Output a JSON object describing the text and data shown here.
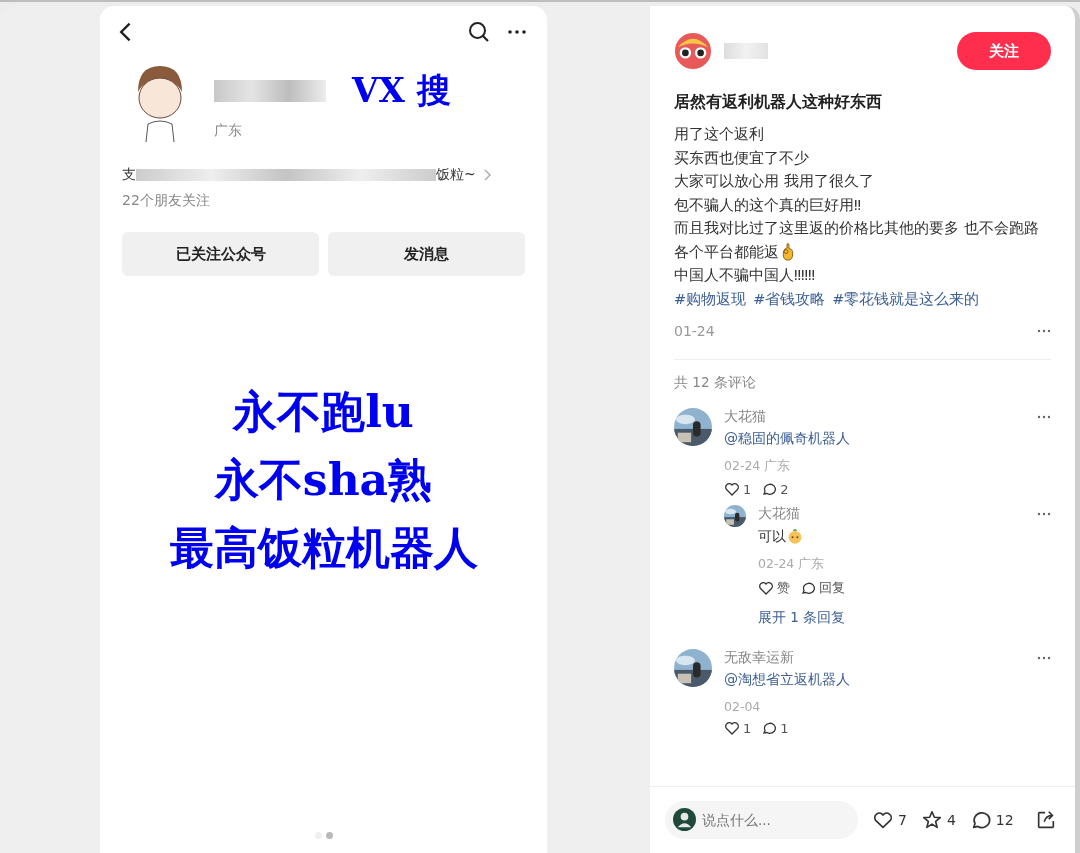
{
  "image_panel": {
    "profile": {
      "vx_label": "VX 搜",
      "region": "广东",
      "bio_start": "支",
      "bio_end": "饭粒~",
      "friends": "22个朋友关注",
      "buttons": [
        "已关注公众号",
        "发消息"
      ]
    },
    "slogan_lines": [
      "永不跑lu",
      "永不sha熟",
      "最高饭粒机器人"
    ],
    "pager": [
      {
        "selected": false
      },
      {
        "selected": true
      }
    ]
  },
  "post": {
    "follow_button": "关注",
    "title": "居然有返利机器人这种好东西",
    "body_lines": [
      {
        "text": "用了这个返利",
        "emoji": false
      },
      {
        "text": "买东西也便宜了不少",
        "emoji": false
      },
      {
        "text": "大家可以放心用 我用了很久了",
        "emoji": false
      },
      {
        "text": "包不骗人的这个真的巨好用‼",
        "emoji": false
      },
      {
        "text": "而且我对比过了这里返的价格比其他的要多 也不会跑路",
        "emoji": false
      },
      {
        "text": "各个平台都能返",
        "emoji": true
      },
      {
        "text": "中国人不骗中国人‼‼‼",
        "emoji": false
      }
    ],
    "tags": [
      "#购物返现",
      "#省钱攻略",
      "#零花钱就是这么来的"
    ],
    "date": "01-24"
  },
  "comments": {
    "count_label": "共 12 条评论",
    "items": [
      {
        "user": "大花猫",
        "text": "@稳固的佩奇机器人",
        "kind": "mention",
        "emoji": false,
        "meta": "02-24 广东",
        "likes": "1",
        "replies": "2",
        "children": [
          {
            "user": "大花猫",
            "text": "可以",
            "kind": "plain",
            "emoji": true,
            "meta": "02-24 广东",
            "likes": "赞",
            "replies": "回复"
          }
        ],
        "expand": "展开 1 条回复"
      },
      {
        "user": "无敌幸运新",
        "text": "@淘想省立返机器人",
        "kind": "mention",
        "emoji": false,
        "meta": "02-04",
        "likes": "1",
        "replies": "1"
      }
    ]
  },
  "bottom_bar": {
    "placeholder": "说点什么...",
    "likes": "7",
    "stars": "4",
    "comments": "12"
  }
}
